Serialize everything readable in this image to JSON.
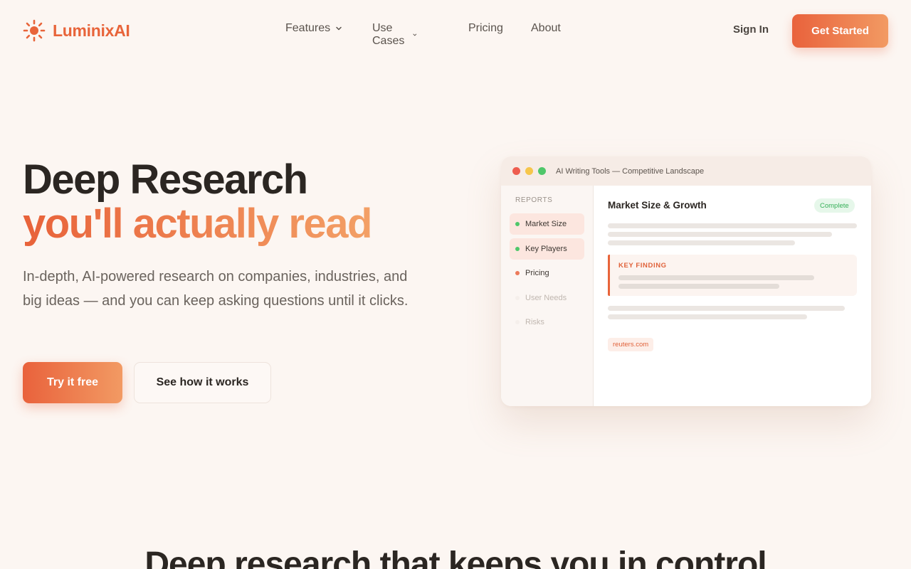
{
  "brand": {
    "name": "LuminixAI",
    "icon": "sun-icon",
    "color": "#e8643a"
  },
  "nav": {
    "links": [
      {
        "label": "Features",
        "dropdown": true
      },
      {
        "label": "Use Cases",
        "dropdown": true
      },
      {
        "label": "Pricing",
        "dropdown": false
      },
      {
        "label": "About",
        "dropdown": false
      }
    ],
    "sign_in": "Sign In",
    "get_started": "Get Started"
  },
  "hero": {
    "title_line1": "Deep Research",
    "title_line2": "you'll actually read",
    "subtitle": "In-depth, AI-powered research on companies, industries, and big ideas — and you can keep asking questions until it clicks.",
    "primary_cta": "Try it free",
    "secondary_cta": "See how it works"
  },
  "app_preview": {
    "window_title": "AI Writing Tools — Competitive Landscape",
    "sidebar_heading": "REPORTS",
    "reports": [
      {
        "label": "Market Size",
        "status": "done",
        "active": true
      },
      {
        "label": "Key Players",
        "status": "done",
        "active": true
      },
      {
        "label": "Pricing",
        "status": "in-progress",
        "active": false
      },
      {
        "label": "User Needs",
        "status": "pending",
        "active": false
      },
      {
        "label": "Risks",
        "status": "pending",
        "active": false
      }
    ],
    "content_title": "Market Size & Growth",
    "status_badge": "Complete",
    "key_finding_label": "KEY FINDING",
    "source": "reuters.com"
  },
  "section": {
    "title": "Deep research that keeps you in control"
  },
  "colors": {
    "accent": "#e8643a",
    "accent_light": "#f29a63",
    "background": "#fcf6f2",
    "success": "#4fc76a",
    "text": "#2b2622"
  }
}
